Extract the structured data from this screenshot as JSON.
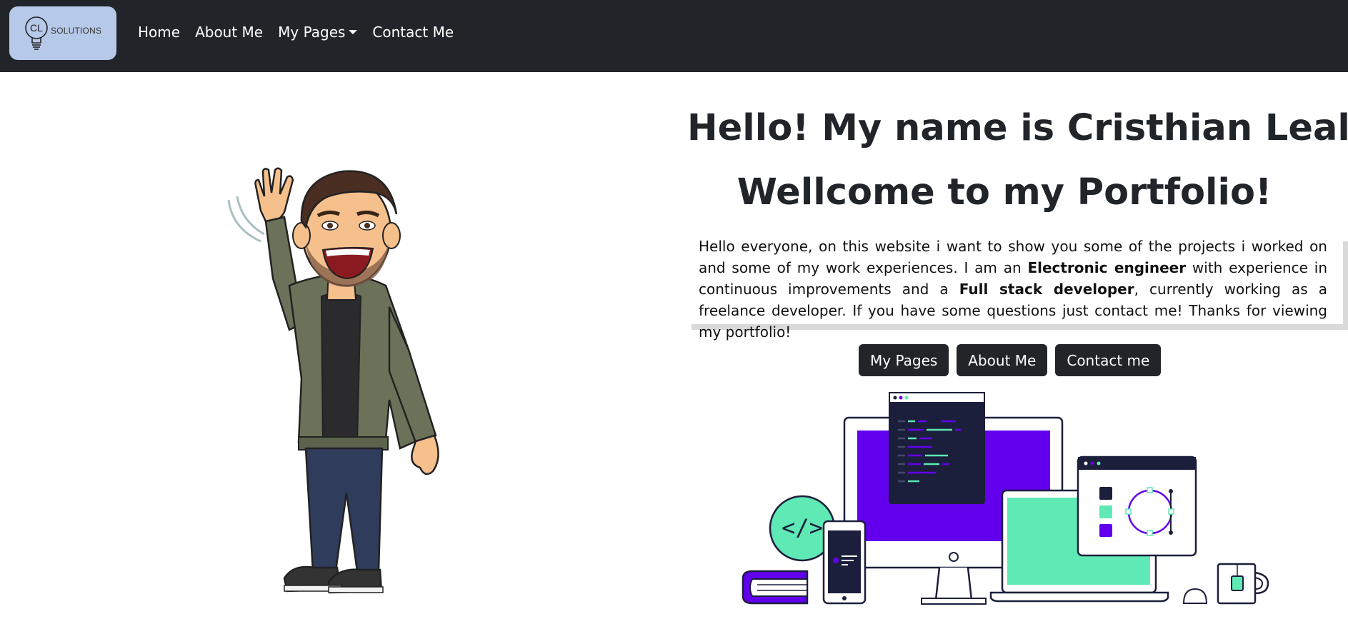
{
  "brand": {
    "logo_initials": "CL",
    "logo_text": "SOLUTIONS"
  },
  "nav": {
    "items": [
      {
        "label": "Home"
      },
      {
        "label": "About Me"
      },
      {
        "label": "My Pages"
      },
      {
        "label": "Contact Me"
      }
    ]
  },
  "hero": {
    "title": "Hello! My name is Cristhian Leal",
    "subtitle": "Wellcome to my Portfolio!",
    "intro_1": "Hello everyone, on this website i want to show you some of the projects i worked on and some of my work experiences. I am an ",
    "intro_bold_1": "Electronic engineer",
    "intro_2": " with experience in continuous improvements and a ",
    "intro_bold_2": "Full stack developer",
    "intro_3": ", currently working as a freelance developer. If you have some questions just contact me! Thanks for viewing my portfolio!"
  },
  "buttons": {
    "pages": "My Pages",
    "about": "About Me",
    "contact": "Contact me"
  },
  "illustration": {
    "code_badge": "</>"
  },
  "colors": {
    "navbar": "#212529",
    "brand_bg": "#b7c9e9",
    "accent_purple": "#6200ee",
    "accent_mint": "#5ee9b5",
    "dark_navy": "#1c1f3b"
  },
  "icons": [
    "lightbulb-icon",
    "caret-down-icon",
    "waving-avatar",
    "developer-devices-illustration"
  ]
}
